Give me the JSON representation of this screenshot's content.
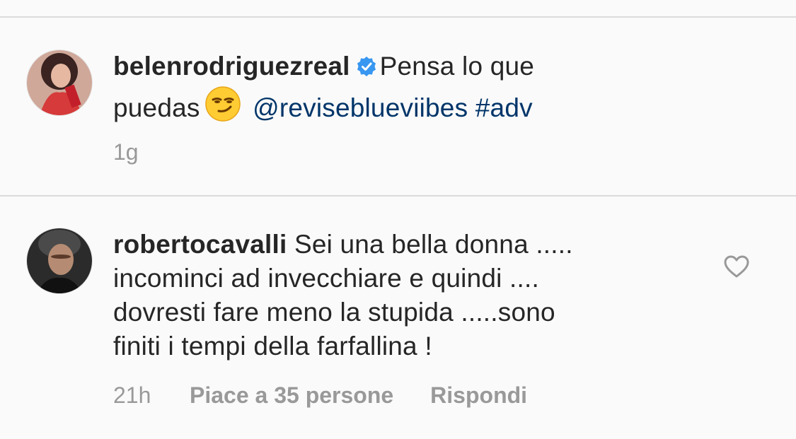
{
  "post": {
    "username": "belenrodriguezreal",
    "caption_line1": "Pensa lo que",
    "caption_line2_text": "puedas",
    "mention": "@reviseblueviibes",
    "hashtag": "#adv",
    "time": "1g",
    "verified_icon": "verified-badge-icon",
    "emoji_icon": "smirking-face-emoji"
  },
  "comment": {
    "username": "robertocavalli",
    "line1": "Sei una bella donna .....",
    "line2": "incominci ad invecchiare e quindi ....",
    "line3": "dovresti fare meno la stupida .....sono",
    "line4": "finiti i tempi della farfallina !",
    "time": "21h",
    "likes": "Piace a 35 persone",
    "reply": "Rispondi",
    "like_icon": "heart-outline-icon"
  },
  "colors": {
    "background": "#fafafa",
    "text": "#262626",
    "link": "#003569",
    "meta": "#999999",
    "verified": "#3897f0",
    "divider": "#dbdbdb"
  }
}
